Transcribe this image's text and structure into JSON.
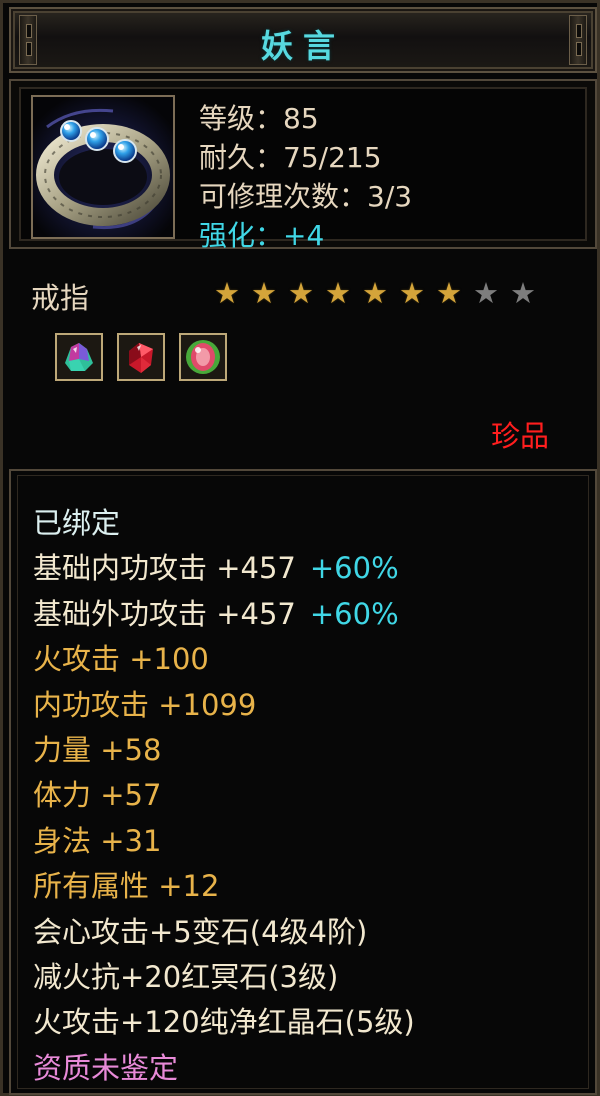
{
  "item": {
    "name": "妖言",
    "stats": {
      "level": "等级：85",
      "durability": "耐久：75/215",
      "repairs": "可修理次数：3/3",
      "enhance": "强化：+4"
    },
    "type": "戒指",
    "stars": {
      "filled": 7,
      "total": 9
    },
    "gems": [
      "rainbow-crystal-icon",
      "red-crystal-icon",
      "green-red-orb-icon"
    ],
    "quality": "珍品"
  },
  "attributes": {
    "bound": "已绑定",
    "base_inner": {
      "label": "基础内功攻击 +457",
      "pct": "+60%"
    },
    "base_outer": {
      "label": "基础外功攻击 +457",
      "pct": "+60%"
    },
    "fire_atk": "火攻击 +100",
    "inner_atk": "内功攻击 +1099",
    "strength": "力量 +58",
    "stamina": "体力 +57",
    "agility": "身法 +31",
    "all_attr": "所有属性 +12",
    "socket_1": "会心攻击+5变石(4级4阶)",
    "socket_2": "减火抗+20红冥石(3级)",
    "socket_3": "火攻击+120纯净红晶石(5级)",
    "aptitude": "资质未鉴定"
  },
  "colors": {
    "title": "#57d9e0",
    "enhance": "#40d7e6",
    "quality": "#ff1e1e",
    "gold_attr": "#e8b34a",
    "aptitude": "#e88ad8"
  }
}
